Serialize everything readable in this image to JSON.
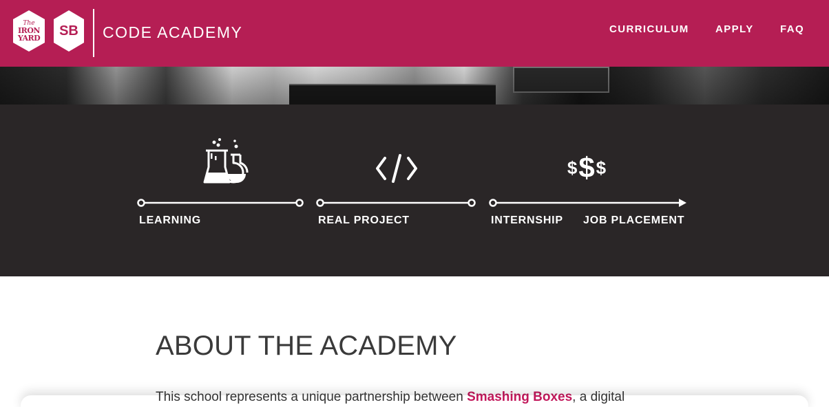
{
  "header": {
    "logo_iron_the": "The",
    "logo_iron_line1": "IRON",
    "logo_iron_line2": "YARD",
    "logo_sb": "SB",
    "brand": "CODE ACADEMY",
    "nav": [
      {
        "label": "CURRICULUM"
      },
      {
        "label": "APPLY"
      },
      {
        "label": "FAQ"
      }
    ],
    "brand_color": "#b51e54"
  },
  "pathway": {
    "steps": [
      {
        "label": "LEARNING",
        "icon": "beakers-icon"
      },
      {
        "label": "REAL PROJECT",
        "icon": "code-brackets-icon"
      },
      {
        "label": "INTERNSHIP",
        "icon": "dollar-signs-icon"
      },
      {
        "label": "JOB PLACEMENT"
      }
    ],
    "money_icon_text": "$$$",
    "background": "#2a2627"
  },
  "about": {
    "title": "ABOUT THE ACADEMY",
    "text_before": "This school represents a unique partnership between ",
    "text_link": "Smashing Boxes",
    "text_after": ", a digital",
    "link_color": "#c2185b"
  }
}
